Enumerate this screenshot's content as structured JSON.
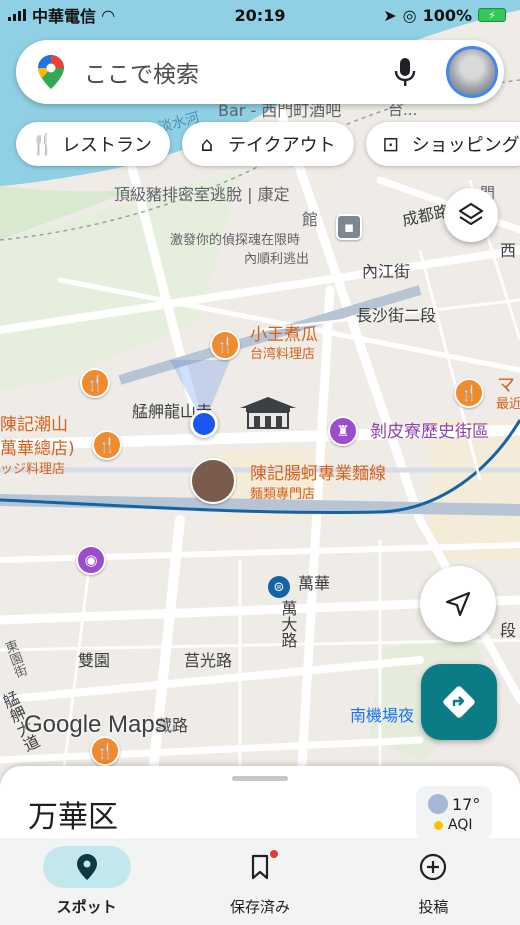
{
  "status_bar": {
    "carrier": "中華電信",
    "time": "20:19",
    "battery": "100%"
  },
  "search": {
    "placeholder": "ここで検索"
  },
  "chips": [
    {
      "icon": "restaurant-icon",
      "label": "レストラン"
    },
    {
      "icon": "takeout-icon",
      "label": "テイクアウト"
    },
    {
      "icon": "shopping-bag-icon",
      "label": "ショッピング"
    }
  ],
  "map": {
    "labels": {
      "bar": "Bar - 西門町酒吧",
      "bar2": "台...",
      "river": "淡水河",
      "escape1": "頂級豬排密室逃脫 | 康定",
      "escape2": "館",
      "escape3": "激發你的偵探魂在限時",
      "escape4": "內順利逃出",
      "chengdu": "成都路",
      "neijiang": "內江街",
      "changsha": "長沙街二段",
      "xiwang_name": "小王煮瓜",
      "xiwang_type": "台湾料理店",
      "temple": "艋舺龍山寺",
      "bopiliao": "剝皮寮歷史街區",
      "chenji1": "陳記腸蚵專業麵線",
      "chenji2": "麵類專門店",
      "chaoshan1": "陳記潮山",
      "chaoshan2": "萬華總店)",
      "chaoshan3": "ッジ料理店",
      "wanhua": "萬華",
      "wanda": "萬大路",
      "shuangyuan": "雙園",
      "juguang": "莒光路",
      "dongyuan": "東園街",
      "yuanzhou": "艋舺大道",
      "zangzhuo": "藏路",
      "nanji": "南機場夜",
      "xi": "西",
      "zuijin": "最近",
      "ma": "マ",
      "men": "門",
      "yuan": "園",
      "duan": "段"
    }
  },
  "google_logo": "Google Maps",
  "sheet": {
    "title": "万華区",
    "temp": "17°",
    "aqi": "AQI"
  },
  "nav": [
    {
      "label": "スポット"
    },
    {
      "label": "保存済み"
    },
    {
      "label": "投稿"
    }
  ]
}
